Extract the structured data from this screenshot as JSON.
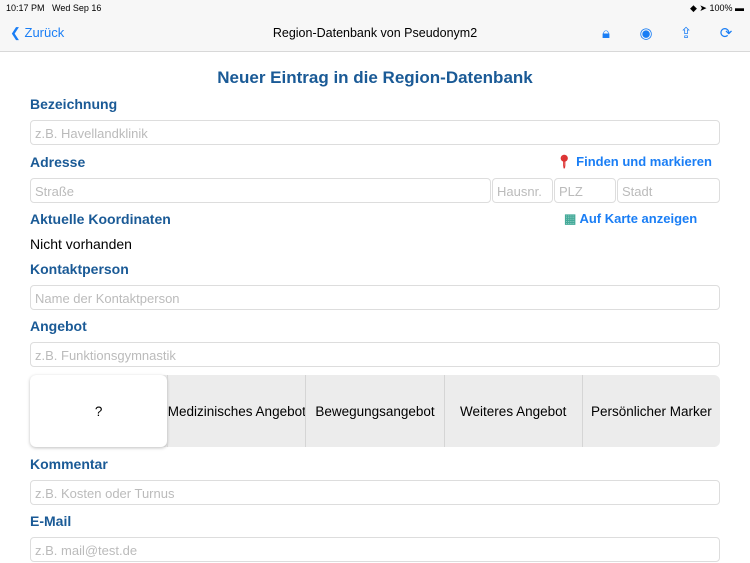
{
  "status": {
    "time": "10:17 PM",
    "date": "Wed Sep 16",
    "battery": "100%"
  },
  "nav": {
    "back": "Zurück",
    "title": "Region-Datenbank von Pseudonym2"
  },
  "form": {
    "heading": "Neuer Eintrag in die Region-Datenbank",
    "bezeichnung_label": "Bezeichnung",
    "bezeichnung_ph": "z.B. Havellandklinik",
    "adresse_label": "Adresse",
    "find_link": "Finden und markieren",
    "strasse_ph": "Straße",
    "hausnr_ph": "Hausnr.",
    "plz_ph": "PLZ",
    "stadt_ph": "Stadt",
    "koord_label": "Aktuelle Koordinaten",
    "map_link": "Auf Karte anzeigen",
    "koord_value": "Nicht vorhanden",
    "kontakt_label": "Kontaktperson",
    "kontakt_ph": "Name der Kontaktperson",
    "angebot_label": "Angebot",
    "angebot_ph": "z.B. Funktionsgymnastik",
    "segments": [
      "?",
      "Medizinisches Angebot",
      "Bewegungsangebot",
      "Weiteres Angebot",
      "Persönlicher Marker"
    ],
    "kommentar_label": "Kommentar",
    "kommentar_ph": "z.B. Kosten oder Turnus",
    "email_label": "E-Mail",
    "email_ph": "z.B. mail@test.de"
  }
}
